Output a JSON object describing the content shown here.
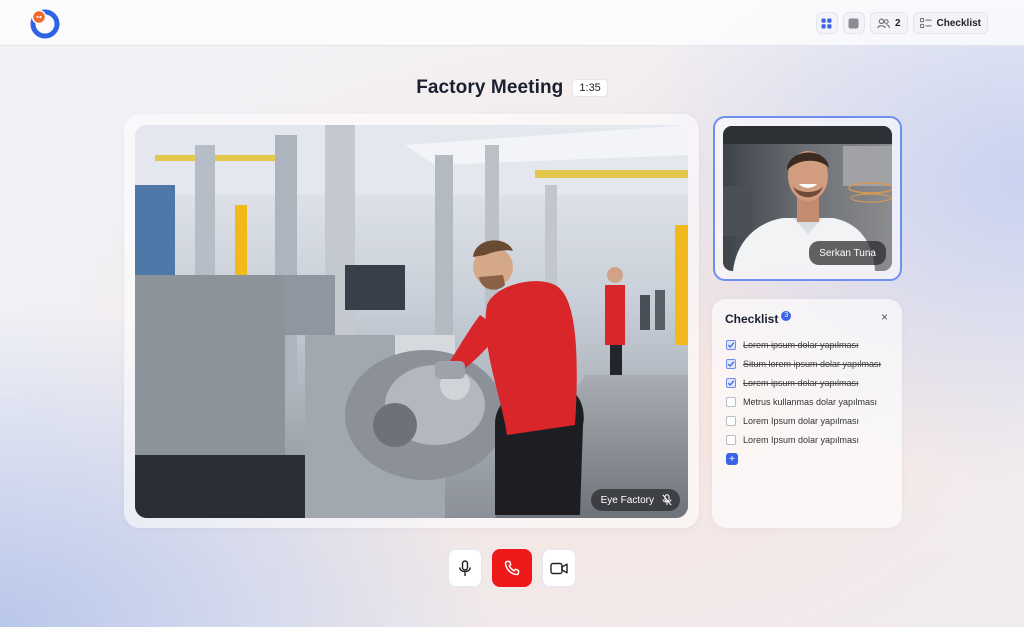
{
  "topbar": {
    "participants_count": "2",
    "checklist_label": "Checklist"
  },
  "meeting": {
    "title": "Factory Meeting",
    "timer": "1:35"
  },
  "main_video": {
    "participant_name": "Eye Factory"
  },
  "side_video": {
    "participant_name": "Serkan Tuna"
  },
  "checklist": {
    "title": "Checklist",
    "badge_count": "3",
    "items": [
      {
        "label": "Lorem ipsum dolar yapılması",
        "checked": true
      },
      {
        "label": "Situm lorem ipsum dolar  yapılması",
        "checked": true
      },
      {
        "label": "Lorem ipsum dolar yapılması",
        "checked": true
      },
      {
        "label": "Metrus kullanmas dolar yapılması",
        "checked": false
      },
      {
        "label": "Lorem Ipsum dolar yapılması",
        "checked": false
      },
      {
        "label": "Lorem Ipsum dolar yapılması",
        "checked": false
      }
    ]
  },
  "colors": {
    "accent": "#3b63e6",
    "end_call": "#f01919",
    "speaker_highlight": "#6f8ff0"
  }
}
